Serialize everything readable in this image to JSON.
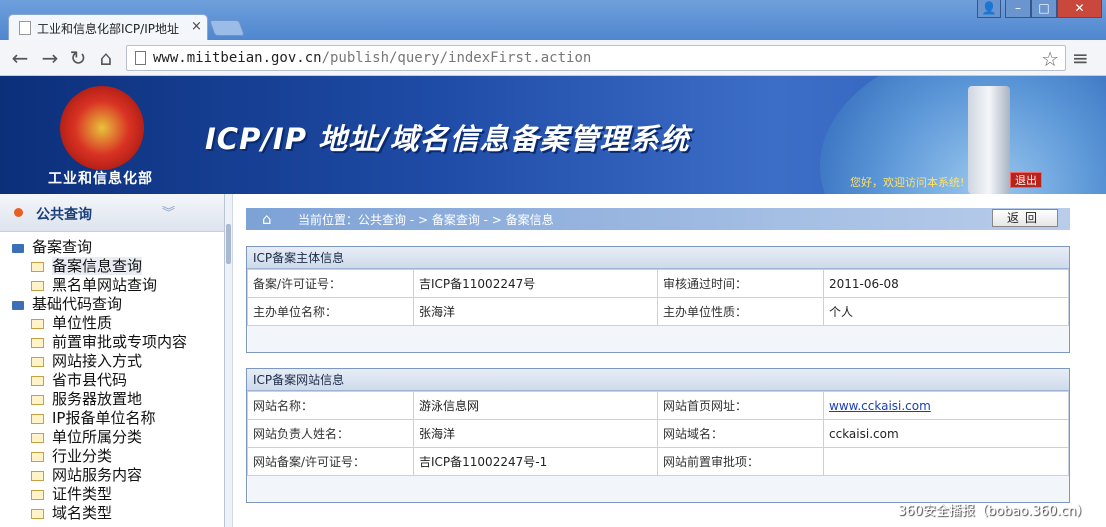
{
  "browser": {
    "tab_title": "工业和信息化部ICP/IP地址",
    "tab_close": "×",
    "url_host": "www.miitbeian.gov.cn",
    "url_path": "/publish/query/indexFirst.action",
    "window_buttons": {
      "user": "👤",
      "min": "–",
      "max": "□",
      "close": "✕"
    },
    "nav": {
      "back": "←",
      "forward": "→",
      "reload": "↻",
      "home": "⌂"
    },
    "icons": [
      "page-icon",
      "star-icon",
      "menu-icon"
    ]
  },
  "banner": {
    "ministry": "工业和信息化部",
    "system_title": "ICP/IP 地址/域名信息备案管理系统",
    "welcome": "您好，欢迎访问本系统!",
    "logout": "退出"
  },
  "sidebar": {
    "title": "公共查询",
    "chevron": "︾",
    "groups": [
      {
        "label": "备案查询",
        "items": [
          "备案信息查询",
          "黑名单网站查询"
        ]
      },
      {
        "label": "基础代码查询",
        "items": [
          "单位性质",
          "前置审批或专项内容",
          "网站接入方式",
          "省市县代码",
          "服务器放置地",
          "IP报备单位名称",
          "单位所属分类",
          "行业分类",
          "网站服务内容",
          "证件类型",
          "域名类型"
        ]
      }
    ]
  },
  "main": {
    "breadcrumb": "当前位置：公共查询 - > 备案查询 - > 备案信息",
    "back_button": "返回",
    "entity_panel": {
      "title": "ICP备案主体信息",
      "rows": [
        [
          "备案/许可证号：",
          "吉ICP备11002247号",
          "审核通过时间：",
          "2011-06-08"
        ],
        [
          "主办单位名称：",
          "张海洋",
          "主办单位性质：",
          "个人"
        ]
      ]
    },
    "site_panel": {
      "title": "ICP备案网站信息",
      "rows": [
        [
          "网站名称：",
          "游泳信息网",
          "网站首页网址：",
          "www.cckaisi.com"
        ],
        [
          "网站负责人姓名：",
          "张海洋",
          "网站域名：",
          "cckaisi.com"
        ],
        [
          "网站备案/许可证号：",
          "吉ICP备11002247号-1",
          "网站前置审批项：",
          ""
        ]
      ]
    }
  },
  "watermark": "360安全播报（bobao.360.cn）"
}
